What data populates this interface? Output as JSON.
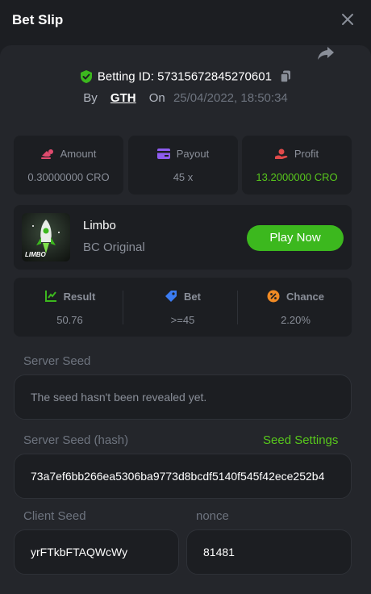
{
  "header": {
    "title": "Bet Slip"
  },
  "bet": {
    "betting_id_label": "Betting ID:",
    "betting_id": "57315672845270601",
    "by_label": "By",
    "user": "GTH",
    "on_label": "On",
    "date": "25/04/2022, 18:50:34"
  },
  "stats": {
    "amount_label": "Amount",
    "amount_value": "0.30000000 CRO",
    "payout_label": "Payout",
    "payout_value": "45 x",
    "profit_label": "Profit",
    "profit_value": "13.2000000 CRO"
  },
  "game": {
    "thumb_label": "LIMBO",
    "name": "Limbo",
    "subtitle": "BC Original",
    "play_label": "Play Now"
  },
  "results": {
    "result_label": "Result",
    "result_value": "50.76",
    "bet_label": "Bet",
    "bet_value": ">=45",
    "chance_label": "Chance",
    "chance_value": "2.20%"
  },
  "seeds": {
    "server_seed_label": "Server Seed",
    "server_seed_value": "The seed hasn't been revealed yet.",
    "server_hash_label": "Server Seed (hash)",
    "seed_settings_label": "Seed Settings",
    "server_hash_value": "73a7ef6bb266ea5306ba9773d8bcdf5140f545f42ece252b4",
    "client_seed_label": "Client Seed",
    "client_seed_value": "yrFTkbFTAQWcWy",
    "nonce_label": "nonce",
    "nonce_value": "81481"
  },
  "colors": {
    "accent_green": "#58c81c",
    "play_button": "#3cb81e",
    "panel": "#24262b",
    "card": "#1c1e22"
  },
  "icons": [
    "close-icon",
    "share-icon",
    "shield-check-icon",
    "copy-icon",
    "amount-icon",
    "payout-card-icon",
    "profit-icon",
    "result-icon",
    "bet-tag-icon",
    "chance-percent-icon",
    "rocket-icon"
  ]
}
